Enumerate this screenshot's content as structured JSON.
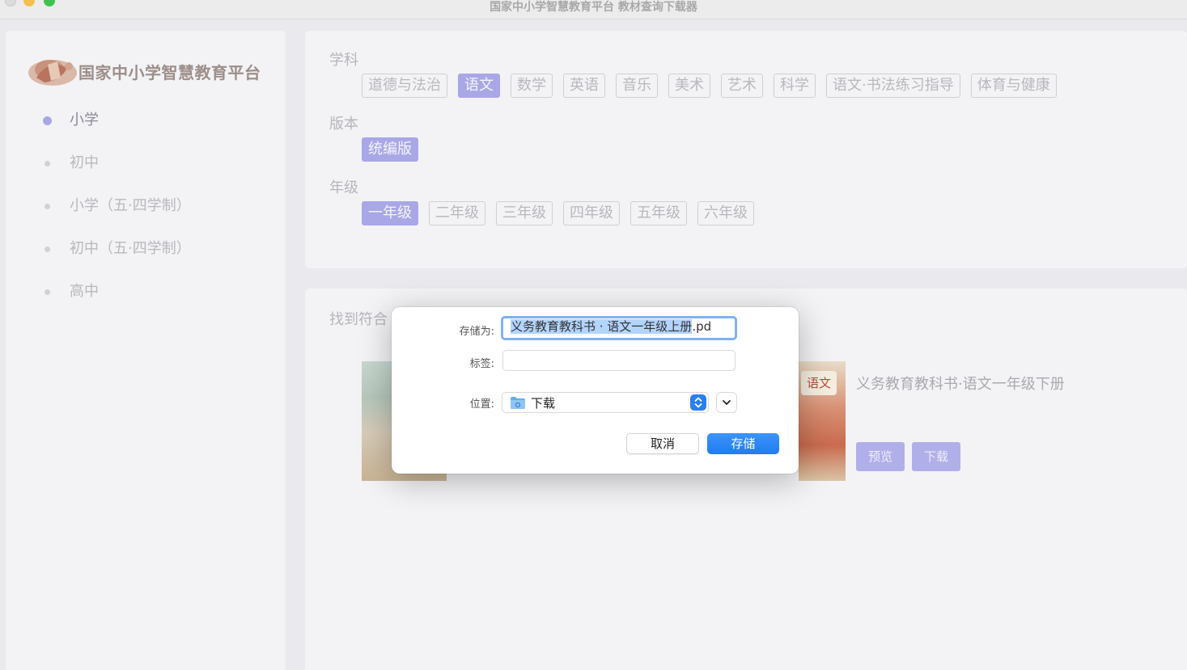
{
  "window": {
    "title": "国家中小学智慧教育平台 教材查询下载器"
  },
  "sidebar": {
    "logo_text": "国家中小学智慧教育平台",
    "items": [
      {
        "label": "小学",
        "active": true
      },
      {
        "label": "初中",
        "active": false
      },
      {
        "label": "小学（五·四学制）",
        "active": false
      },
      {
        "label": "初中（五·四学制）",
        "active": false
      },
      {
        "label": "高中",
        "active": false
      }
    ]
  },
  "filters": {
    "subject": {
      "label": "学科",
      "options": [
        "道德与法治",
        "语文",
        "数学",
        "英语",
        "音乐",
        "美术",
        "艺术",
        "科学",
        "语文·书法练习指导",
        "体育与健康"
      ],
      "selected": "语文"
    },
    "edition": {
      "label": "版本",
      "options": [
        "统编版"
      ],
      "selected": "统编版"
    },
    "grade": {
      "label": "年级",
      "options": [
        "一年级",
        "二年级",
        "三年级",
        "四年级",
        "五年级",
        "六年级"
      ],
      "selected": "一年级"
    }
  },
  "results": {
    "title_visible": "找到符合",
    "book2": {
      "title": "义务教育教科书·语文一年级下册",
      "cover_badge": "语文",
      "preview_label": "预览",
      "download_label": "下载"
    }
  },
  "save_dialog": {
    "save_as_label": "存储为:",
    "filename_selected": "义务教育教科书 · 语文一年级上册",
    "filename_ext": ".pd",
    "tags_label": "标签:",
    "tags_value": "",
    "location_label": "位置:",
    "location_value": "下载",
    "cancel_label": "取消",
    "save_label": "存储",
    "accent_color": "#2b7ff2"
  },
  "colors": {
    "chip_selected": "#a9a7e6",
    "traffic_min": "#f5bf4f",
    "traffic_max": "#3fc24f"
  }
}
